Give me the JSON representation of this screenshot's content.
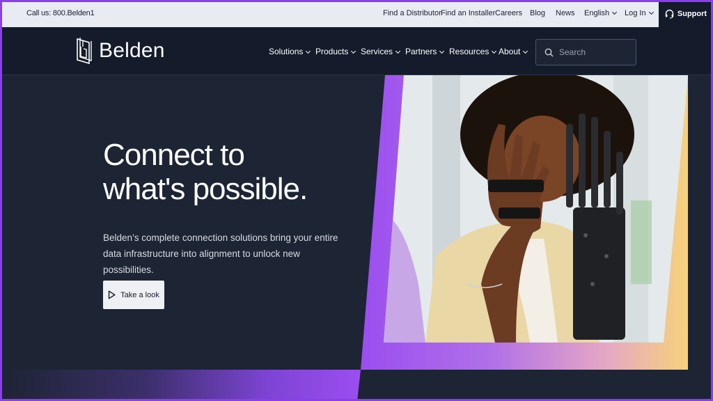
{
  "utility": {
    "call": "Call us: 800.Belden1",
    "links": [
      "Find a Distributor",
      "Find an Installer",
      "Careers",
      "Blog",
      "News"
    ],
    "language": "English",
    "login": "Log In",
    "support": "Support"
  },
  "brand": {
    "name": "Belden"
  },
  "nav": {
    "items": [
      "Solutions",
      "Products",
      "Services",
      "Partners",
      "Resources",
      "About"
    ],
    "search_placeholder": "Search"
  },
  "hero": {
    "title_line1": "Connect to",
    "title_line2": "what's possible.",
    "subtitle": "Belden’s complete connection solutions bring your entire data infrastructure into alignment to unlock new possibilities.",
    "cta": "Take a look"
  },
  "colors": {
    "accent": "#9b4ef0",
    "nav_bg": "#141b2b",
    "hero_bg": "#1d2433",
    "utility_bg": "#e8ebf1"
  }
}
